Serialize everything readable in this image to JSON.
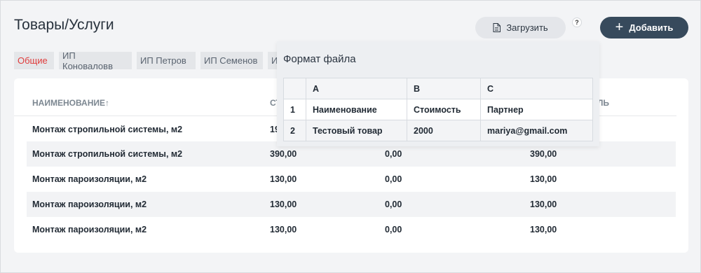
{
  "header": {
    "title": "Товары/Услуги",
    "upload_label": "Загрузить",
    "help_label": "?",
    "add_label": "Добавить"
  },
  "tabs": [
    {
      "label": "Общие",
      "active": true
    },
    {
      "label": "ИП Коноваловв",
      "active": false
    },
    {
      "label": "ИП Петров",
      "active": false
    },
    {
      "label": "ИП Семенов",
      "active": false
    },
    {
      "label": "ИП",
      "active": false
    }
  ],
  "table": {
    "columns": [
      "НАИМЕНОВАНИЕ",
      "СТ",
      "ЛЬ"
    ],
    "sort_indicator": "↑",
    "rows": [
      [
        "Монтаж стропильной системы, м2",
        "19",
        "",
        ""
      ],
      [
        "Монтаж стропильной системы, м2",
        "390,00",
        "0,00",
        "390,00"
      ],
      [
        "Монтаж пароизоляции, м2",
        "130,00",
        "0,00",
        "130,00"
      ],
      [
        "Монтаж пароизоляции, м2",
        "130,00",
        "0,00",
        "130,00"
      ],
      [
        "Монтаж пароизоляции, м2",
        "130,00",
        "0,00",
        "130,00"
      ]
    ]
  },
  "popup": {
    "title": "Формат файла",
    "header": [
      "",
      "A",
      "B",
      "C"
    ],
    "rows": [
      [
        "1",
        "Наименование",
        "Стоимость",
        "Партнер"
      ],
      [
        "2",
        "Тестовый товар",
        "2000",
        "mariya@gmail.com"
      ]
    ]
  },
  "colors": {
    "accent_dark": "#374a5c",
    "active_tab_text": "#e03c3c",
    "row_alt": "#f2f3f5"
  }
}
